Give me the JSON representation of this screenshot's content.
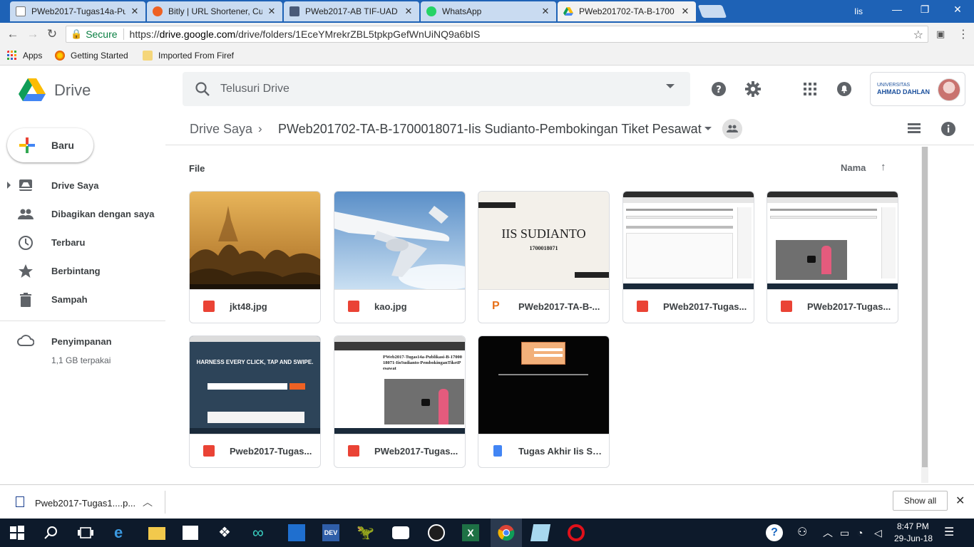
{
  "browser": {
    "tabs": [
      {
        "title": "PWeb2017-Tugas14a-Pul",
        "icon": "document-icon",
        "color": "#ffffff"
      },
      {
        "title": "Bitly | URL Shortener, Cus",
        "icon": "bitly-icon",
        "color": "#ee6123"
      },
      {
        "title": "PWeb2017-AB TIF-UAD",
        "icon": "contact-icon",
        "color": "#4a5a78"
      },
      {
        "title": "WhatsApp",
        "icon": "whatsapp-icon",
        "color": "#25d366"
      },
      {
        "title": "PWeb201702-TA-B-1700",
        "icon": "drive-icon",
        "color": "#fbbc04"
      }
    ],
    "profile": "Iis",
    "address": {
      "secure_label": "Secure",
      "url_scheme": "https://",
      "url_host": "drive.google.com",
      "url_path": "/drive/folders/1EceYMrekrZBL5tpkpGefWnUiNQ9a6bIS"
    },
    "bookmarks": [
      {
        "label": "Apps",
        "icon": "apps-grid-icon"
      },
      {
        "label": "Getting Started",
        "icon": "firefox-icon"
      },
      {
        "label": "Imported From Firef",
        "icon": "folder-icon"
      }
    ]
  },
  "drive": {
    "title": "Drive",
    "search_placeholder": "Telusuri Drive",
    "org": {
      "line1": "UNIVERSITAS",
      "line2": "AHMAD DAHLAN"
    },
    "new_button": "Baru",
    "nav": [
      {
        "label": "Drive Saya",
        "icon": "my-drive-icon"
      },
      {
        "label": "Dibagikan dengan saya",
        "icon": "people-icon"
      },
      {
        "label": "Terbaru",
        "icon": "clock-icon"
      },
      {
        "label": "Berbintang",
        "icon": "star-icon"
      },
      {
        "label": "Sampah",
        "icon": "trash-icon"
      }
    ],
    "storage": {
      "label": "Penyimpanan",
      "used": "1,1 GB terpakai"
    },
    "breadcrumb": {
      "root": "Drive Saya",
      "current": "PWeb201702-TA-B-1700018071-Iis Sudianto-Pembokingan Tiket Pesawat"
    },
    "section": "File",
    "sort": "Nama",
    "files": [
      {
        "name": "jkt48.jpg",
        "type": "image",
        "thumb": "temple"
      },
      {
        "name": "kao.jpg",
        "type": "image",
        "thumb": "airplane"
      },
      {
        "name": "PWeb2017-TA-B-...",
        "type": "slides",
        "thumb": "title-slide",
        "slide_title": "IIS SUDIANTO",
        "slide_sub": "1700018071"
      },
      {
        "name": "PWeb2017-Tugas...",
        "type": "image",
        "thumb": "screenshot-form"
      },
      {
        "name": "PWeb2017-Tugas...",
        "type": "image",
        "thumb": "screenshot-video"
      },
      {
        "name": "Pweb2017-Tugas...",
        "type": "image",
        "thumb": "bitly-page",
        "thumb_headline": "HARNESS EVERY CLICK, TAP AND SWIPE."
      },
      {
        "name": "PWeb2017-Tugas...",
        "type": "image",
        "thumb": "doc-video",
        "thumb_headline": "PWeb2017-Tugas14a-Publikasi-B-1700018071-IisSudianto-PembokinganTiketPesawat"
      },
      {
        "name": "Tugas Akhir Iis Su...",
        "type": "doc",
        "thumb": "black-form"
      }
    ]
  },
  "downloads": {
    "item": "Pweb2017-Tugas1....p...",
    "show_all": "Show all"
  },
  "taskbar": {
    "time": "8:47 PM",
    "date": "29-Jun-18"
  }
}
